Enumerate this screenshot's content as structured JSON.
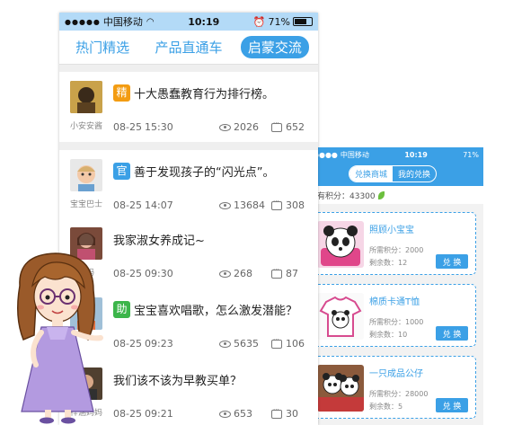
{
  "forum": {
    "status": {
      "carrier": "中国移动",
      "time": "10:19",
      "battery": "71%"
    },
    "tabs": [
      {
        "label": "热门精选",
        "active": false
      },
      {
        "label": "产品直通车",
        "active": false
      },
      {
        "label": "启蒙交流",
        "active": true
      }
    ],
    "posts": [
      {
        "user": "小安安酱",
        "badge": "精",
        "badge_color": "#f39c12",
        "title": "十大愚蠢教育行为排行榜。",
        "date": "08-25",
        "time": "15:30",
        "views": "2026",
        "comments": "652"
      },
      {
        "user": "宝宝巴士",
        "badge": "官",
        "badge_color": "#3ba0e6",
        "title": "善于发现孩子的“闪光点”。",
        "date": "08-25",
        "time": "14:07",
        "views": "13684",
        "comments": "308"
      },
      {
        "user": "妈妈",
        "badge": "",
        "badge_color": "",
        "title": "我家淑女养成记~",
        "date": "08-25",
        "time": "09:30",
        "views": "268",
        "comments": "87"
      },
      {
        "user": "",
        "badge": "助",
        "badge_color": "#3cb54a",
        "title": "宝宝喜欢唱歌，怎么激发潜能？",
        "date": "08-25",
        "time": "09:23",
        "views": "5635",
        "comments": "106"
      },
      {
        "user": "梓涵妈妈",
        "badge": "",
        "badge_color": "",
        "title": "我们该不该为早教买单？",
        "date": "08-25",
        "time": "09:21",
        "views": "653",
        "comments": "30"
      }
    ]
  },
  "shop": {
    "status": {
      "carrier": "中国移动",
      "time": "10:19",
      "battery": "71%"
    },
    "tabs": [
      {
        "label": "兑换商城",
        "active": true
      },
      {
        "label": "我的兑换",
        "active": false
      }
    ],
    "total_points_label": "共有积分：43300",
    "items": [
      {
        "name": "照顾小宝宝",
        "points": "所需积分：2000",
        "remaining": "剩余数：12",
        "button": "兑 换"
      },
      {
        "name": "棉质卡通T恤",
        "points": "所需积分：1000",
        "remaining": "剩余数：10",
        "button": "兑 换"
      },
      {
        "name": "一只成品公仔",
        "points": "所需积分：28000",
        "remaining": "剩余数：5",
        "button": "兑 换"
      }
    ]
  }
}
